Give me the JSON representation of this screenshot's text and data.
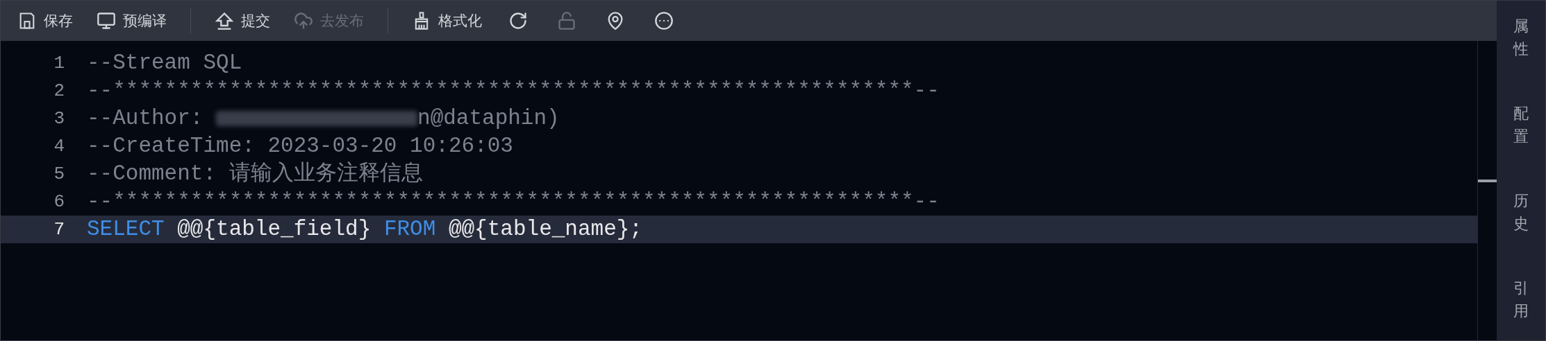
{
  "toolbar": [
    {
      "kind": "button",
      "label": "保存",
      "disabled": false
    },
    {
      "kind": "button",
      "label": "预编译",
      "disabled": false
    },
    {
      "kind": "divider"
    },
    {
      "kind": "button",
      "label": "提交",
      "disabled": false
    },
    {
      "kind": "button",
      "label": "去发布",
      "disabled": true
    },
    {
      "kind": "divider"
    },
    {
      "kind": "button",
      "label": "格式化",
      "disabled": false
    },
    {
      "kind": "icon",
      "disabled": false
    },
    {
      "kind": "icon",
      "disabled": true
    },
    {
      "kind": "icon",
      "disabled": false
    },
    {
      "kind": "icon",
      "disabled": false
    }
  ],
  "editor": {
    "lines": [
      {
        "number": "1",
        "selected": false,
        "tokens": [
          {
            "kind": "comment",
            "text": "--Stream SQL"
          }
        ]
      },
      {
        "number": "2",
        "selected": false,
        "tokens": [
          {
            "kind": "comment",
            "text": "--**************************************************************--"
          }
        ]
      },
      {
        "number": "3",
        "selected": false,
        "tokens": [
          {
            "kind": "comment",
            "text": "--Author: "
          },
          {
            "kind": "redacted"
          },
          {
            "kind": "comment",
            "text": "n@dataphin)"
          }
        ]
      },
      {
        "number": "4",
        "selected": false,
        "tokens": [
          {
            "kind": "comment",
            "text": "--CreateTime: 2023-03-20 10:26:03"
          }
        ]
      },
      {
        "number": "5",
        "selected": false,
        "tokens": [
          {
            "kind": "comment",
            "text": "--Comment: 请输入业务注释信息"
          }
        ]
      },
      {
        "number": "6",
        "selected": false,
        "tokens": [
          {
            "kind": "comment",
            "text": "--**************************************************************--"
          }
        ]
      },
      {
        "number": "7",
        "selected": true,
        "tokens": [
          {
            "kind": "keyword",
            "text": "SELECT"
          },
          {
            "kind": "plain",
            "text": " @@{table_field} "
          },
          {
            "kind": "keyword",
            "text": "FROM"
          },
          {
            "kind": "plain",
            "text": " @@{table_name};"
          }
        ]
      }
    ]
  },
  "side_panel": {
    "tabs": [
      {
        "label": "属性"
      },
      {
        "label": "配置"
      },
      {
        "label": "历史"
      },
      {
        "label": "引用"
      }
    ]
  }
}
